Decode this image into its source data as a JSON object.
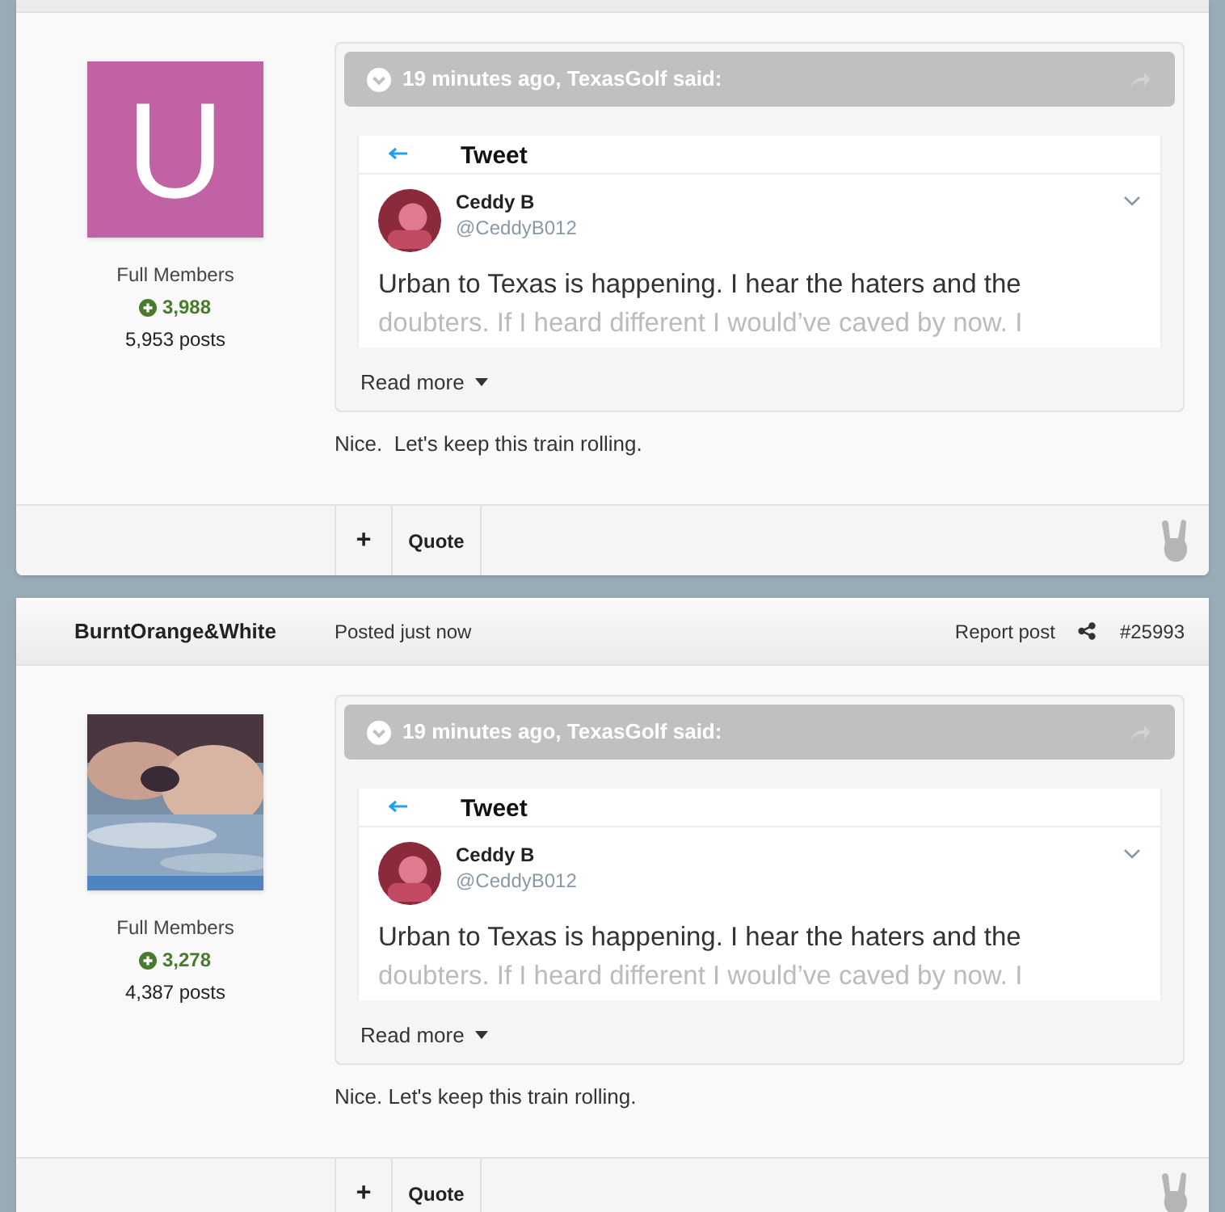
{
  "posts": [
    {
      "avatar": {
        "kind": "letter",
        "letter": "U",
        "color": "#c062a4"
      },
      "group": "Full Members",
      "reputation": "3,988",
      "post_count": "5,953 posts",
      "quote": {
        "header": "19 minutes ago, TexasGolf said:",
        "tweet": {
          "title": "Tweet",
          "name": "Ceddy B",
          "handle": "@CeddyB012",
          "lines": [
            "Urban to Texas is happening. I hear the haters and the",
            "doubters. If I heard different I would’ve caved by now. I"
          ]
        },
        "read_more": "Read more"
      },
      "text": "Nice.  Let's keep this train rolling.",
      "actions": [
        "+",
        "Quote"
      ]
    },
    {
      "header": {
        "author": "BurntOrange&White",
        "posted": "Posted just now",
        "report": "Report post",
        "number": "#25993"
      },
      "group": "Full Members",
      "reputation": "3,278",
      "post_count": "4,387 posts",
      "quote": {
        "header": "19 minutes ago, TexasGolf said:",
        "tweet": {
          "title": "Tweet",
          "name": "Ceddy B",
          "handle": "@CeddyB012",
          "lines": [
            "Urban to Texas is happening. I hear the haters and the",
            "doubters. If I heard different I would’ve caved by now. I"
          ]
        },
        "read_more": "Read more"
      },
      "text": "Nice. Let's keep this train rolling.",
      "actions": [
        "+",
        "Quote"
      ]
    }
  ]
}
